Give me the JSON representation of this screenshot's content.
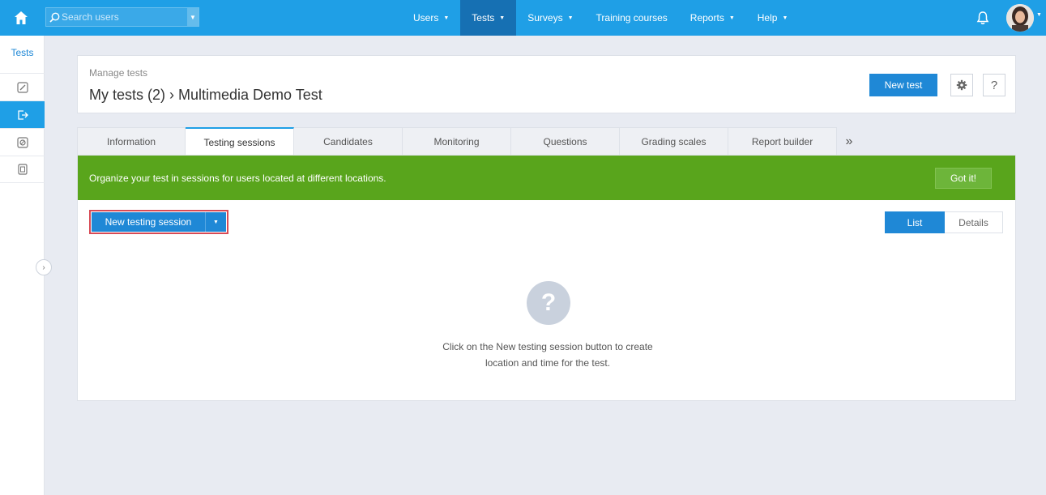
{
  "topbar": {
    "search_placeholder": "Search users",
    "nav": [
      {
        "label": "Users",
        "has_caret": true
      },
      {
        "label": "Tests",
        "has_caret": true,
        "active": true
      },
      {
        "label": "Surveys",
        "has_caret": true
      },
      {
        "label": "Training courses",
        "has_caret": false
      },
      {
        "label": "Reports",
        "has_caret": true
      },
      {
        "label": "Help",
        "has_caret": true
      }
    ],
    "caret": "▼"
  },
  "sidebar": {
    "label": "Tests",
    "items": [
      {
        "icon": "edit-icon"
      },
      {
        "icon": "sessions-icon",
        "active": true
      },
      {
        "icon": "monitoring-icon"
      },
      {
        "icon": "reports-icon"
      }
    ],
    "collapse_glyph": "›"
  },
  "header": {
    "section": "Manage tests",
    "title": "My tests (2) › Multimedia Demo Test",
    "new_test_label": "New test",
    "help_label": "?"
  },
  "tabs": [
    {
      "label": "Information"
    },
    {
      "label": "Testing sessions",
      "active": true
    },
    {
      "label": "Candidates"
    },
    {
      "label": "Monitoring"
    },
    {
      "label": "Questions"
    },
    {
      "label": "Grading scales"
    },
    {
      "label": "Report builder"
    }
  ],
  "tabs_more": "»",
  "banner": {
    "text": "Organize your test in sessions for users located at different locations.",
    "button_label": "Got it!",
    "color": "#59a51c"
  },
  "content": {
    "new_session_label": "New testing session",
    "drop_glyph": "▼",
    "view_list_label": "List",
    "view_details_label": "Details",
    "empty_icon_glyph": "?",
    "empty_line1": "Click on the New testing session button to create",
    "empty_line2": "location and time for the test."
  },
  "colors": {
    "topbar": "#1f9fe6",
    "active_nav": "#1670b3",
    "primary_button": "#1f88d6",
    "highlight_border": "#d84a55"
  }
}
